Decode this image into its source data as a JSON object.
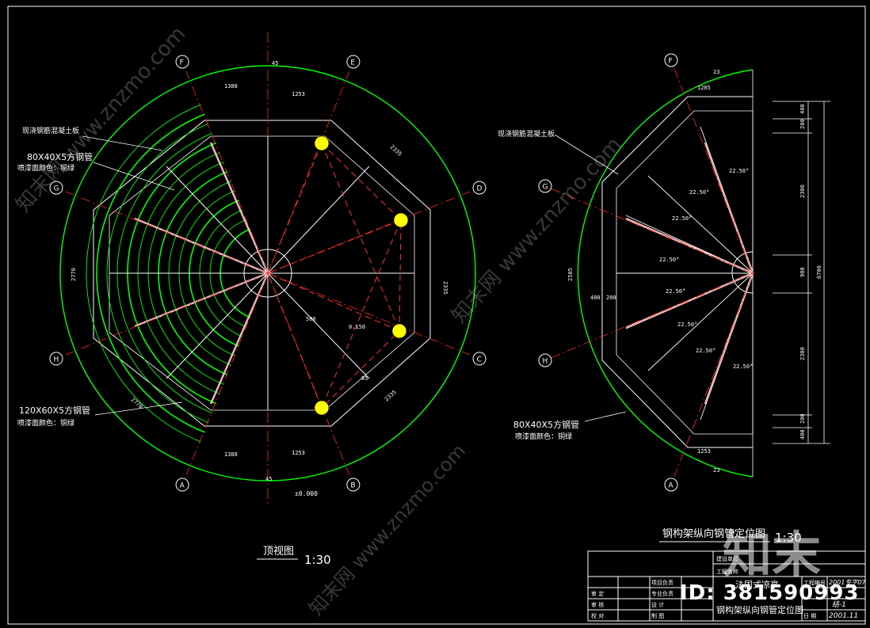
{
  "colors": {
    "background": "#000000",
    "outline": "#00ff00",
    "structure": "#ffffff",
    "axis": "#ff2a2a",
    "dim": "#ff4040",
    "node": "#ffff00",
    "watermark": "#ffffff"
  },
  "left_plan": {
    "title": "顶视图",
    "scale": "1:30",
    "axis_labels": [
      "F",
      "E",
      "D",
      "C",
      "B",
      "A",
      "H",
      "G"
    ],
    "dims": {
      "top_arc": "45",
      "top_seg_1": "1388",
      "top_seg_2": "1253",
      "side_h": "2770",
      "side_h_right": "2335",
      "right_v": "2335",
      "left_v": "2770",
      "bottom_seg_1": "1388",
      "bottom_seg_2": "1253",
      "diag": "2335",
      "small_a": "45",
      "small_b": "85",
      "small_c": "500"
    },
    "level_mark": "0.150",
    "level_base": "±0.000",
    "notes": {
      "concrete": "现浇钢筋混凝土板",
      "tube_small": "80X40X5方钢管",
      "paint_small": "喷漆面颜色：铜绿",
      "tube_large": "120X60X5方钢管",
      "paint_large": "喷漆面颜色：铜绿"
    }
  },
  "right_plan": {
    "title": "钢构架纵向钢管定位图",
    "scale": "1:30",
    "axis_labels": [
      "F",
      "G",
      "H",
      "A"
    ],
    "dims": {
      "top_seg": "1285",
      "side_total": "6700",
      "side_1": "400",
      "side_2": "200",
      "side_3": "2300",
      "side_4": "900",
      "side_5": "2300",
      "side_6": "200",
      "side_7": "400",
      "left_v": "2505",
      "bottom_seg": "1253",
      "inner_1": "400",
      "inner_2": "200",
      "angle": "22.50°",
      "arc_top": "23",
      "arc_bottom": "23"
    },
    "notes": {
      "concrete": "现浇钢筋混凝土板",
      "tube": "80X40X5方钢管",
      "paint": "喷漆面颜色：铜绿"
    }
  },
  "title_block": {
    "project": "法国式凉亭",
    "drawing": "钢构架纵向钢管定位图",
    "fields": [
      "项目负责",
      "专业负责",
      "设 计",
      "制 图",
      "审 定",
      "审 核",
      "校 对"
    ],
    "no_label": "工程编号",
    "no_value": "2001专字07",
    "sheet": "结-1",
    "date_label": "日 期",
    "date_value": "2001.11",
    "unit_label": "建设单位",
    "project_label": "工程名称"
  },
  "watermark": {
    "text": "知末网 www.znzmo.com",
    "brand": "知末",
    "id": "ID: 381590993"
  }
}
